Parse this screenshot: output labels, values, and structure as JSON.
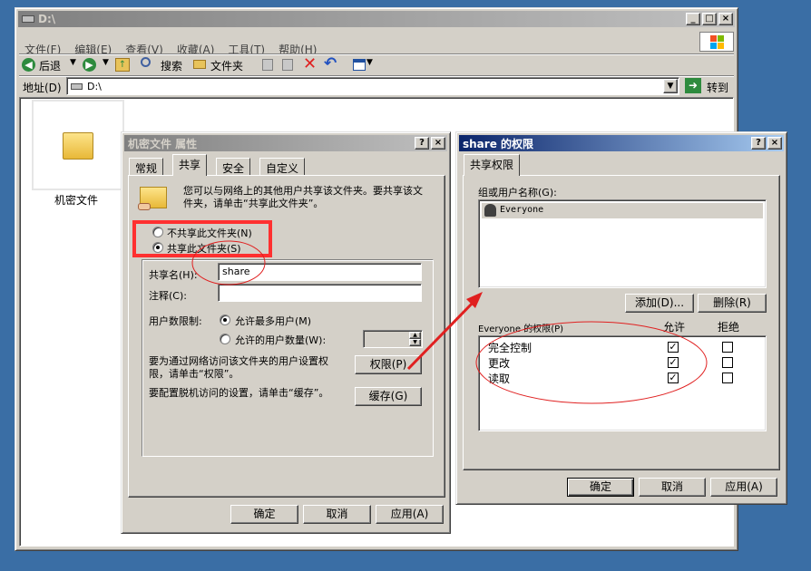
{
  "explorer": {
    "title": "D:\\",
    "menu": [
      "文件(F)",
      "编辑(E)",
      "查看(V)",
      "收藏(A)",
      "工具(T)",
      "帮助(H)"
    ],
    "toolbar": {
      "back": "后退",
      "search": "搜索",
      "folders": "文件夹"
    },
    "address_label": "地址(D)",
    "address_value": "D:\\",
    "go_label": "转到",
    "folder_name": "机密文件"
  },
  "props": {
    "title": "机密文件 属性",
    "tabs": [
      "常规",
      "共享",
      "安全",
      "自定义"
    ],
    "desc": "您可以与网络上的其他用户共享该文件夹。要共享该文件夹，请单击“共享此文件夹”。",
    "no_share": "不共享此文件夹(N)",
    "share": "共享此文件夹(S)",
    "share_name_label": "共享名(H):",
    "share_name_value": "share",
    "comment_label": "注释(C):",
    "user_limit_label": "用户数限制:",
    "max_users": "允许最多用户(M)",
    "allow_users": "允许的用户数量(W):",
    "perm_desc": "要为通过网络访问该文件夹的用户设置权限，请单击“权限”。",
    "perm_button": "权限(P)",
    "cache_desc": "要配置脱机访问的设置，请单击“缓存”。",
    "cache_button": "缓存(G)",
    "ok": "确定",
    "cancel": "取消",
    "apply": "应用(A)"
  },
  "perms": {
    "title": "share 的权限",
    "tab": "共享权限",
    "group_label": "组或用户名称(G):",
    "user": "Everyone",
    "add": "添加(D)...",
    "remove": "删除(R)",
    "perm_header": "Everyone 的权限(P)",
    "allow": "允许",
    "deny": "拒绝",
    "rows": [
      {
        "name": "完全控制",
        "allow": true,
        "deny": false
      },
      {
        "name": "更改",
        "allow": true,
        "deny": false
      },
      {
        "name": "读取",
        "allow": true,
        "deny": false
      }
    ],
    "ok": "确定",
    "cancel": "取消",
    "apply": "应用(A)"
  },
  "colors": {
    "desktop": "#3a6ea5",
    "annotation": "#e02020",
    "highlight_box": "#ff3030"
  }
}
